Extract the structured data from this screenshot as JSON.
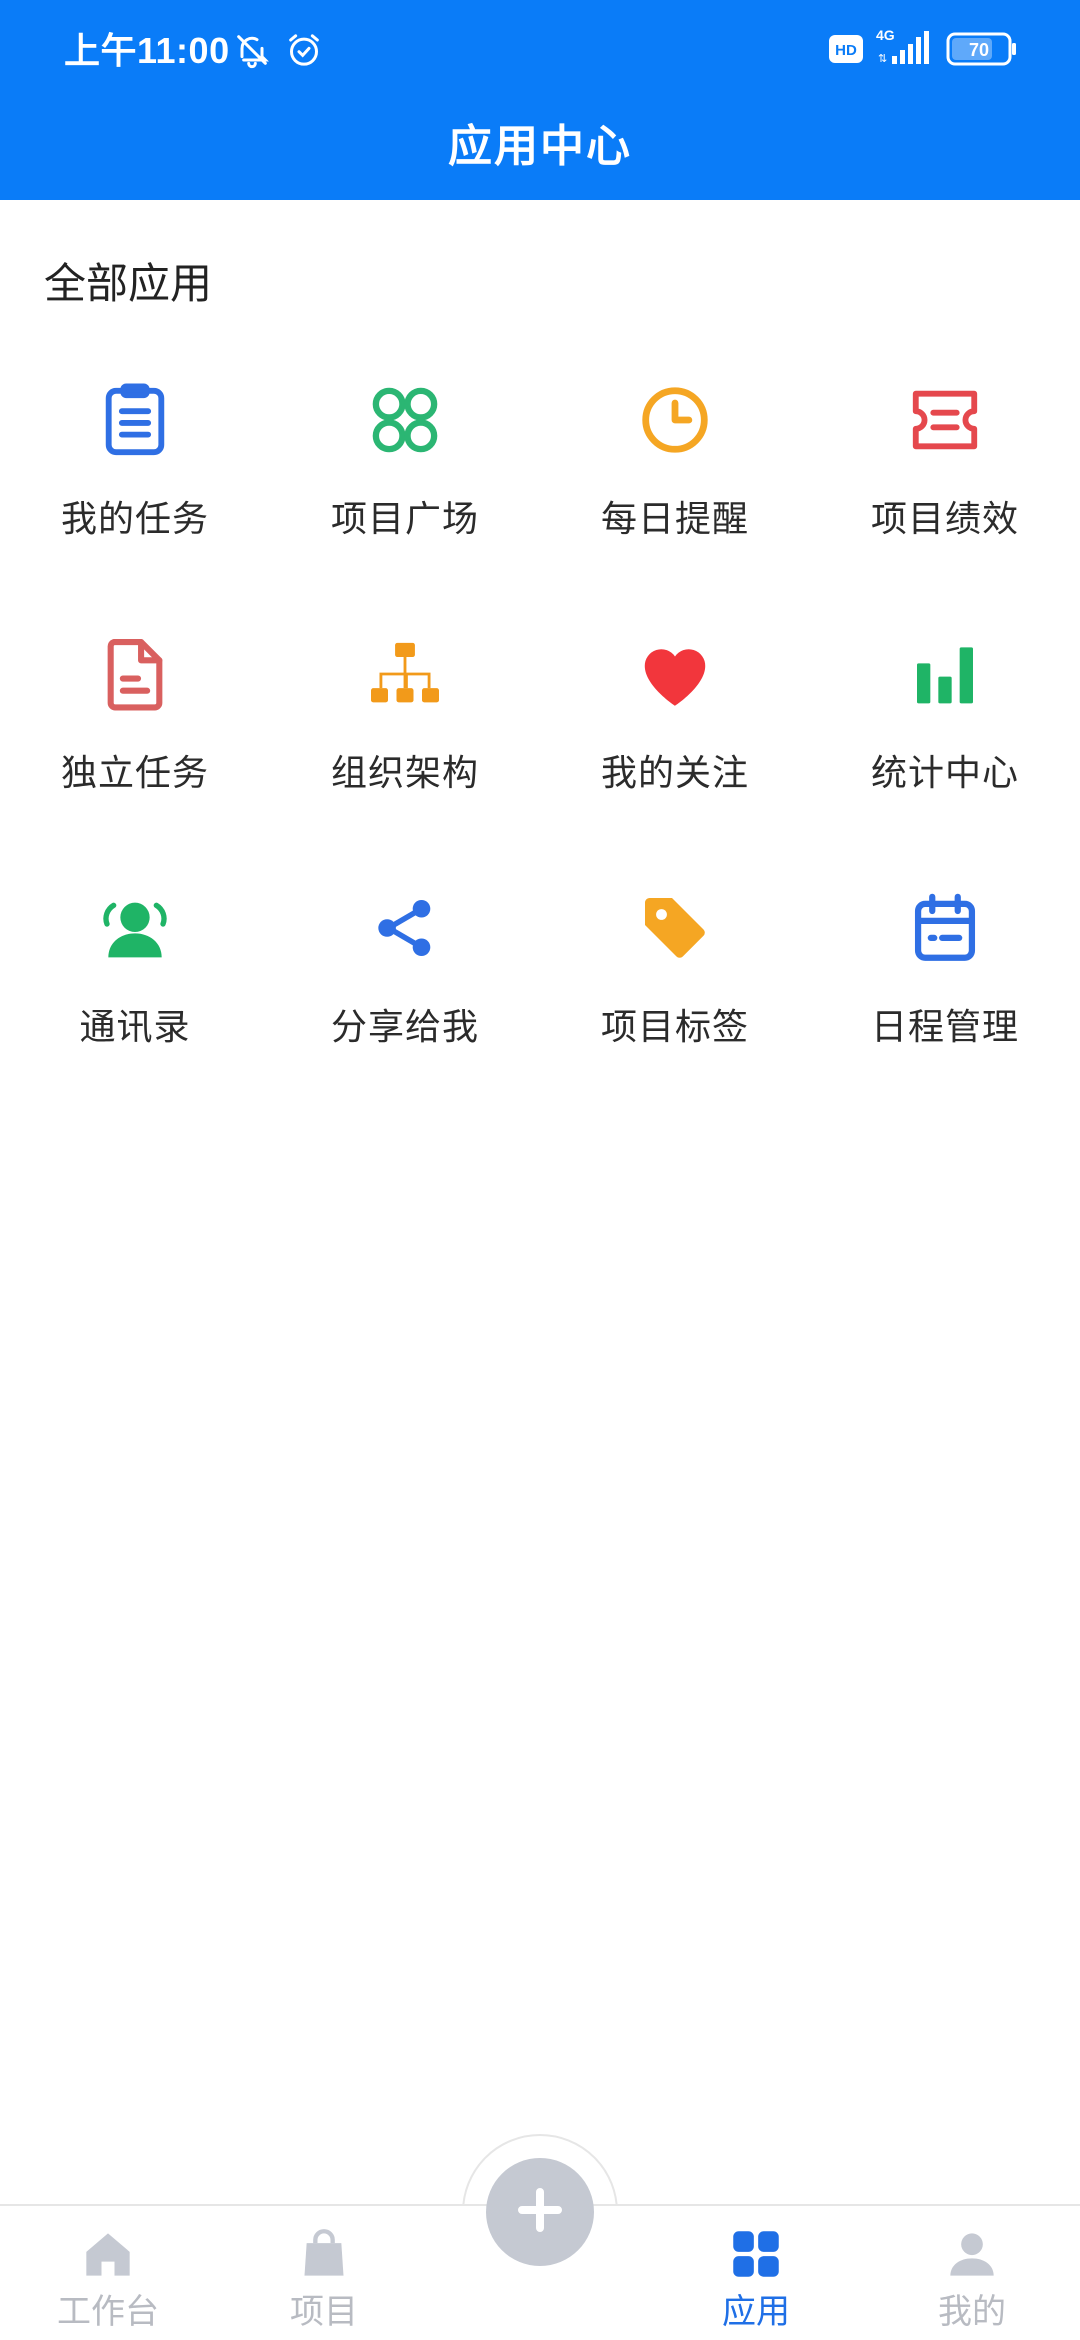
{
  "status_bar": {
    "time": "上午11:00",
    "network": "4G",
    "battery": "70"
  },
  "header": {
    "title": "应用中心"
  },
  "section": {
    "title": "全部应用"
  },
  "apps": [
    {
      "label": "我的任务",
      "icon": "clipboard-icon",
      "color": "#2F6FE4"
    },
    {
      "label": "项目广场",
      "icon": "four-circles-icon",
      "color": "#2BB673"
    },
    {
      "label": "每日提醒",
      "icon": "clock-icon",
      "color": "#F5A623"
    },
    {
      "label": "项目绩效",
      "icon": "ticket-icon",
      "color": "#E5484D"
    },
    {
      "label": "独立任务",
      "icon": "document-icon",
      "color": "#D9605F"
    },
    {
      "label": "组织架构",
      "icon": "org-chart-icon",
      "color": "#F29A1A"
    },
    {
      "label": "我的关注",
      "icon": "heart-icon",
      "color": "#F2363C"
    },
    {
      "label": "统计中心",
      "icon": "bar-chart-icon",
      "color": "#1FB466"
    },
    {
      "label": "通讯录",
      "icon": "contacts-icon",
      "color": "#1FB466"
    },
    {
      "label": "分享给我",
      "icon": "share-icon",
      "color": "#2F6FE4"
    },
    {
      "label": "项目标签",
      "icon": "tag-icon",
      "color": "#F5A623"
    },
    {
      "label": "日程管理",
      "icon": "calendar-icon",
      "color": "#2F6FE4"
    }
  ],
  "tabbar": {
    "items": [
      {
        "label": "工作台",
        "icon": "home-icon",
        "active": false
      },
      {
        "label": "项目",
        "icon": "bag-icon",
        "active": false
      },
      {
        "label": "应用",
        "icon": "grid-icon",
        "active": true
      },
      {
        "label": "我的",
        "icon": "user-icon",
        "active": false
      }
    ],
    "active_color": "#1F6FE6",
    "inactive_color": "#B8BBC2",
    "fab_icon": "plus-icon"
  },
  "colors": {
    "header_bg": "#0A7CF8"
  }
}
